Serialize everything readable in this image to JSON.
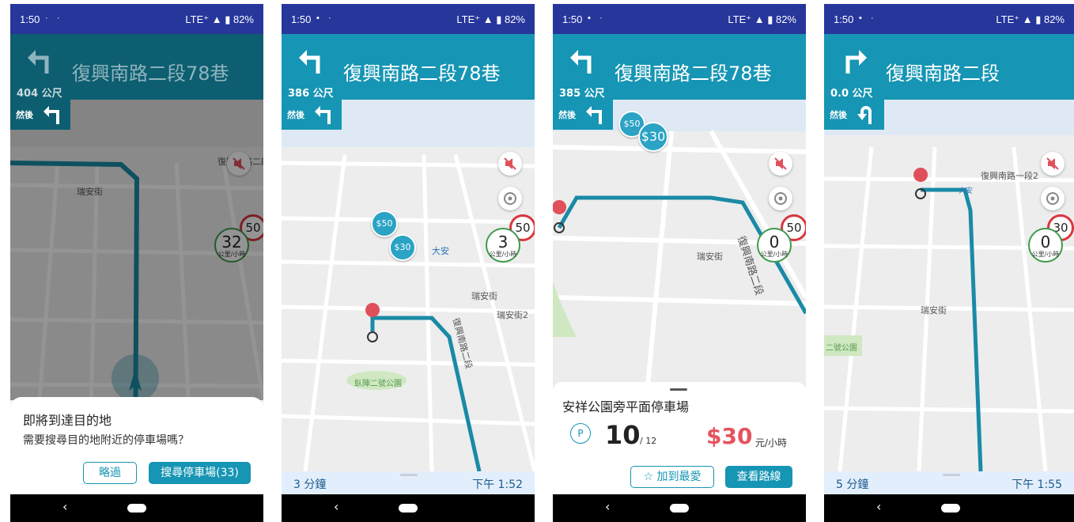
{
  "screens": [
    {
      "status": {
        "time": "1:50",
        "network": "LTE⁺",
        "battery": "82%"
      },
      "nav": {
        "street": "復興南路二段78巷",
        "distance": "404 公尺",
        "then_label": "然後"
      },
      "map": {
        "current_speed": "32",
        "speed_unit": "公里/小時",
        "speed_limit": "50",
        "labels": [
          "瑞安街",
          "復興南路二段"
        ]
      },
      "dialog": {
        "title": "即將到達目的地",
        "message": "需要搜尋目的地附近的停車場嗎？",
        "skip_label": "略過",
        "search_label": "搜尋停車場(33)"
      }
    },
    {
      "status": {
        "time": "1:50",
        "network": "LTE⁺",
        "battery": "82%"
      },
      "nav": {
        "street": "復興南路二段78巷",
        "distance": "386 公尺",
        "then_label": "然後"
      },
      "map": {
        "current_speed": "3",
        "speed_unit": "公里/小時",
        "speed_limit": "50",
        "labels": [
          "大安",
          "大安",
          "瑞安街",
          "瑞安街2",
          "復興南路二段",
          "臥陣二號公園"
        ],
        "price_pins": [
          "$50",
          "$30"
        ]
      },
      "bottom": {
        "eta_duration": "3 分鐘",
        "arrival_time": "下午 1:52"
      }
    },
    {
      "status": {
        "time": "1:50",
        "network": "LTE⁺",
        "battery": "82%"
      },
      "nav": {
        "street": "復興南路二段78巷",
        "distance": "385 公尺",
        "then_label": "然後"
      },
      "map": {
        "current_speed": "0",
        "speed_unit": "公里/小時",
        "speed_limit": "50",
        "labels": [
          "瑞安街",
          "復興南路二段"
        ],
        "price_pins": [
          "$50",
          "$30"
        ]
      },
      "parking": {
        "name": "安祥公園旁平面停車場",
        "parking_icon": "P",
        "available": "10",
        "total": "/ 12",
        "price": "$30",
        "price_unit": "元/小時",
        "favorite_label": "☆ 加到最愛",
        "route_label": "查看路線"
      }
    },
    {
      "status": {
        "time": "1:50",
        "network": "LTE⁺",
        "battery": "82%"
      },
      "nav": {
        "street": "復興南路二段",
        "distance": "0.0 公尺",
        "then_label": "然後"
      },
      "map": {
        "current_speed": "0",
        "speed_unit": "公里/小時",
        "speed_limit": "30",
        "labels": [
          "復興南路一段2",
          "瑞安街",
          "二號公園",
          "大安"
        ]
      },
      "bottom": {
        "eta_duration": "5 分鐘",
        "arrival_time": "下午 1:55"
      }
    }
  ]
}
